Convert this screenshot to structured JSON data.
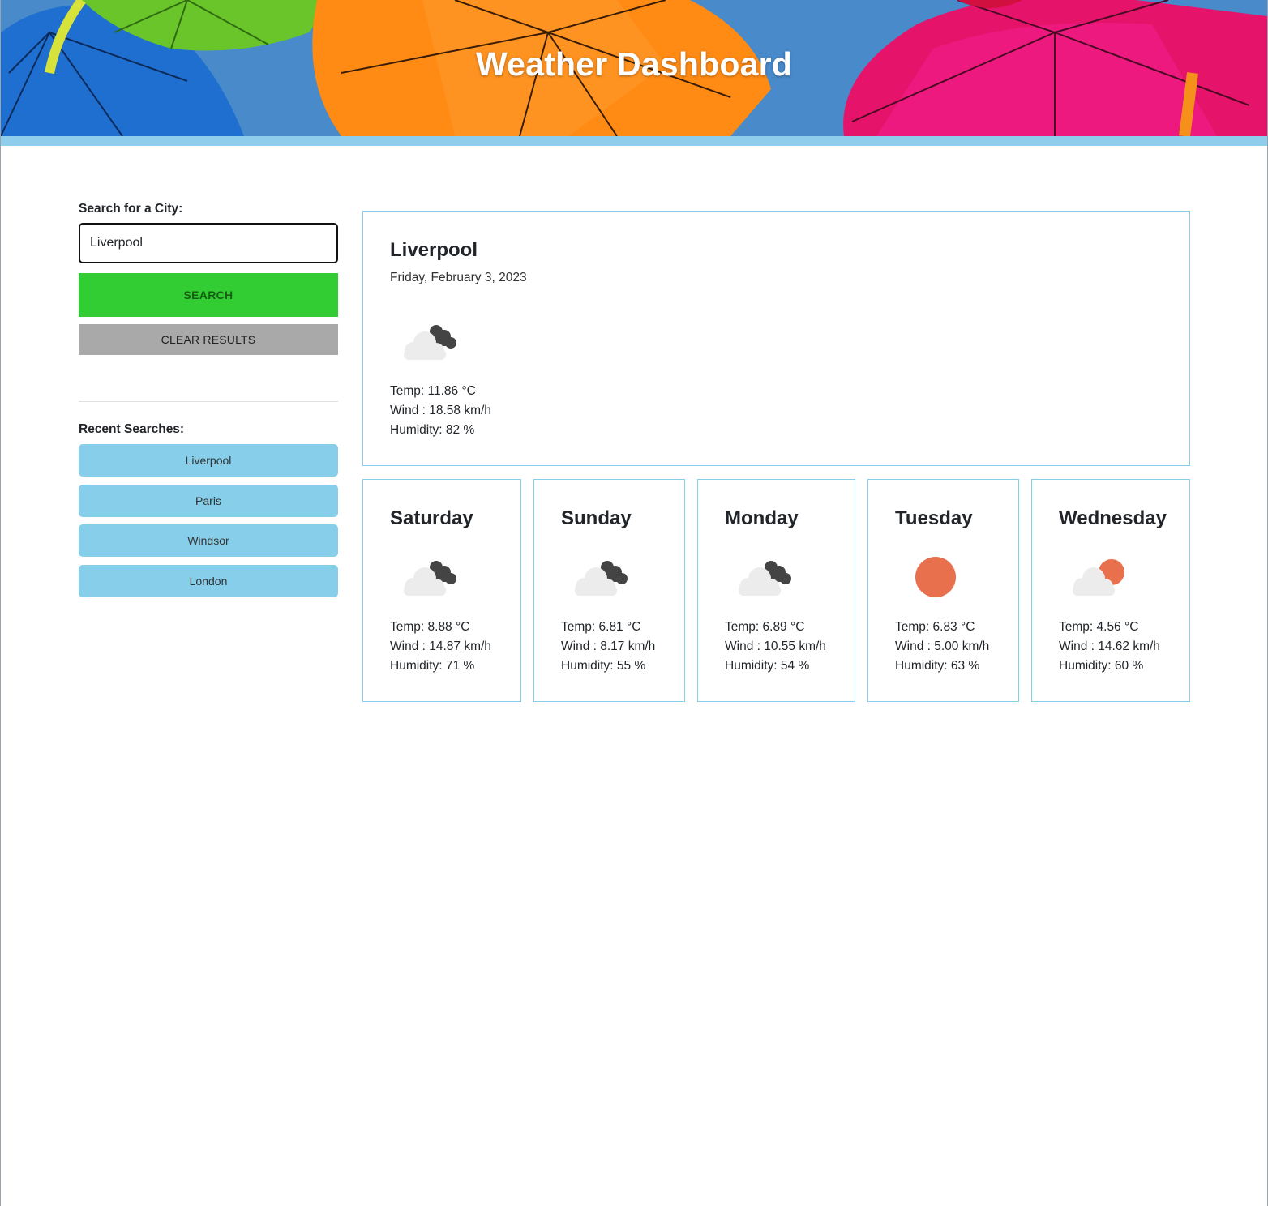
{
  "header": {
    "title": "Weather Dashboard"
  },
  "search": {
    "label": "Search for a City:",
    "value": "Liverpool",
    "placeholder": "",
    "search_button": "SEARCH",
    "clear_button": "CLEAR RESULTS"
  },
  "recent": {
    "label": "Recent Searches:",
    "items": [
      "Liverpool",
      "Paris",
      "Windsor",
      "London"
    ]
  },
  "today": {
    "city": "Liverpool",
    "date": "Friday, February 3, 2023",
    "icon": "broken-clouds-icon",
    "temp": "Temp: 11.86 °C",
    "wind": "Wind : 18.58 km/h",
    "humidity": "Humidity: 82 %"
  },
  "forecast": [
    {
      "day": "Saturday",
      "icon": "broken-clouds-icon",
      "temp": "Temp: 8.88 °C",
      "wind": "Wind : 14.87 km/h",
      "humidity": "Humidity: 71 %"
    },
    {
      "day": "Sunday",
      "icon": "broken-clouds-icon",
      "temp": "Temp: 6.81 °C",
      "wind": "Wind : 8.17 km/h",
      "humidity": "Humidity: 55 %"
    },
    {
      "day": "Monday",
      "icon": "broken-clouds-icon",
      "temp": "Temp: 6.89 °C",
      "wind": "Wind : 10.55 km/h",
      "humidity": "Humidity: 54 %"
    },
    {
      "day": "Tuesday",
      "icon": "clear-sky-icon",
      "temp": "Temp: 6.83 °C",
      "wind": "Wind : 5.00 km/h",
      "humidity": "Humidity: 63 %"
    },
    {
      "day": "Wednesday",
      "icon": "few-clouds-icon",
      "temp": "Temp: 4.56 °C",
      "wind": "Wind : 14.62 km/h",
      "humidity": "Humidity: 60 %"
    }
  ],
  "colors": {
    "accent": "#87ceeb",
    "search_button": "#32cd32",
    "clear_button": "#a9a9a9",
    "sun": "#e8704d"
  }
}
